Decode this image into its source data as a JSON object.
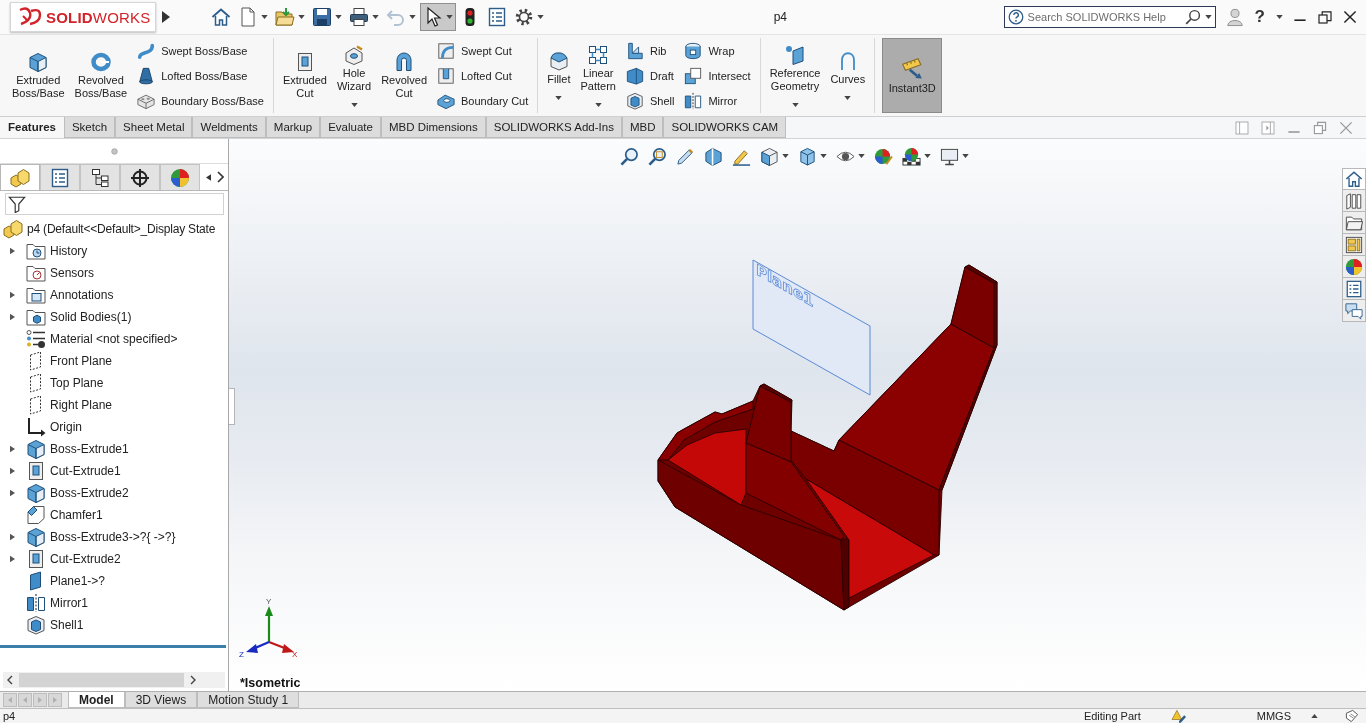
{
  "title_bar": {
    "logo": "**SOLID**WORKS",
    "document_title": "p4",
    "search": {
      "placeholder": "Search SOLIDWORKS Help"
    },
    "help_label": "?"
  },
  "quick_access_toolbar": [
    {
      "dropdown": false,
      "disabled": false,
      "selected": false
    },
    {
      "dropdown": true,
      "disabled": false,
      "selected": false
    },
    {
      "dropdown": true,
      "disabled": false,
      "selected": false
    },
    {
      "dropdown": true,
      "disabled": false,
      "selected": false
    },
    {
      "dropdown": true,
      "disabled": false,
      "selected": false
    },
    {
      "dropdown": true,
      "disabled": true,
      "selected": false
    },
    {
      "dropdown": true,
      "disabled": false,
      "selected": true
    },
    {
      "dropdown": false,
      "disabled": false,
      "selected": false
    },
    {
      "dropdown": false,
      "disabled": false,
      "selected": false
    },
    {
      "dropdown": true,
      "disabled": false,
      "selected": false
    }
  ],
  "ribbon": {
    "groups": [
      {
        "items": [
          {
            "kind": "large",
            "label": "Extruded Boss/Base",
            "dropdown": false
          },
          {
            "kind": "large",
            "label": "Revolved Boss/Base",
            "dropdown": false
          },
          {
            "kind": "stack",
            "entries": [
              "Swept Boss/Base",
              "Lofted Boss/Base",
              "Boundary Boss/Base"
            ]
          }
        ]
      },
      {
        "items": [
          {
            "kind": "large",
            "label": "Extruded Cut",
            "dropdown": false
          },
          {
            "kind": "large",
            "label": "Hole Wizard",
            "dropdown": true
          },
          {
            "kind": "large",
            "label": "Revolved Cut",
            "dropdown": false
          },
          {
            "kind": "stack",
            "entries": [
              "Swept Cut",
              "Lofted Cut",
              "Boundary Cut"
            ]
          }
        ]
      },
      {
        "items": [
          {
            "kind": "large",
            "label": "Fillet",
            "dropdown": true
          },
          {
            "kind": "large",
            "label": "Linear Pattern",
            "dropdown": true
          },
          {
            "kind": "stack",
            "entries": [
              "Rib",
              "Draft",
              "Shell"
            ]
          },
          {
            "kind": "stack",
            "entries": [
              "Wrap",
              "Intersect",
              "Mirror"
            ]
          }
        ]
      },
      {
        "items": [
          {
            "kind": "large",
            "label": "Reference Geometry",
            "dropdown": true
          },
          {
            "kind": "large",
            "label": "Curves",
            "dropdown": true
          }
        ]
      },
      {
        "items": [
          {
            "kind": "toggle",
            "label": "Instant3D",
            "selected": true
          }
        ]
      }
    ]
  },
  "command_tabs": [
    {
      "label": "Features",
      "selected": true
    },
    {
      "label": "Sketch",
      "selected": false
    },
    {
      "label": "Sheet Metal",
      "selected": false
    },
    {
      "label": "Weldments",
      "selected": false
    },
    {
      "label": "Markup",
      "selected": false
    },
    {
      "label": "Evaluate",
      "selected": false
    },
    {
      "label": "MBD Dimensions",
      "selected": false
    },
    {
      "label": "SOLIDWORKS Add-Ins",
      "selected": false
    },
    {
      "label": "MBD",
      "selected": false
    },
    {
      "label": "SOLIDWORKS CAM",
      "selected": false
    }
  ],
  "feature_manager": {
    "tabs": [
      {
        "selected": true
      },
      {
        "selected": false
      },
      {
        "selected": false
      },
      {
        "selected": false
      },
      {
        "selected": false
      }
    ],
    "tree": {
      "label": "p4 (Default<<Default>_Display State",
      "children": [
        {
          "label": "History",
          "expanded": false
        },
        {
          "label": "Sensors"
        },
        {
          "label": "Annotations",
          "expanded": false
        },
        {
          "label": "Solid Bodies(1)",
          "expanded": false
        },
        {
          "label": "Material <not specified>"
        },
        {
          "label": "Front Plane"
        },
        {
          "label": "Top Plane"
        },
        {
          "label": "Right Plane"
        },
        {
          "label": "Origin"
        },
        {
          "label": "Boss-Extrude1",
          "expanded": false
        },
        {
          "label": "Cut-Extrude1",
          "expanded": false
        },
        {
          "label": "Boss-Extrude2",
          "expanded": false
        },
        {
          "label": "Chamfer1"
        },
        {
          "label": "Boss-Extrude3->?{ ->?}",
          "expanded": false
        },
        {
          "label": "Cut-Extrude2",
          "expanded": false
        },
        {
          "label": "Plane1->?"
        },
        {
          "label": "Mirror1"
        },
        {
          "label": "Shell1"
        }
      ]
    }
  },
  "viewport": {
    "heads_up_toolbar": [
      {
        "dropdown": false
      },
      {
        "dropdown": false
      },
      {
        "dropdown": false
      },
      {
        "dropdown": false
      },
      {
        "dropdown": false
      },
      {
        "dropdown": true
      },
      {
        "dropdown": true
      },
      {
        "dropdown": true
      },
      {
        "dropdown": false
      },
      {
        "dropdown": true
      },
      {
        "dropdown": true
      }
    ],
    "plane_label": "Plane1",
    "triad": {
      "x_label": "X",
      "y_label": "Y",
      "z_label": "Z"
    },
    "view_name": "*Isometric"
  },
  "bottom_tabs": [
    {
      "label": "Model",
      "selected": true
    },
    {
      "label": "3D Views",
      "selected": false
    },
    {
      "label": "Motion Study 1",
      "selected": false
    }
  ],
  "status_bar": {
    "document": "p4",
    "mode": "Editing Part",
    "units": "MMGS"
  }
}
